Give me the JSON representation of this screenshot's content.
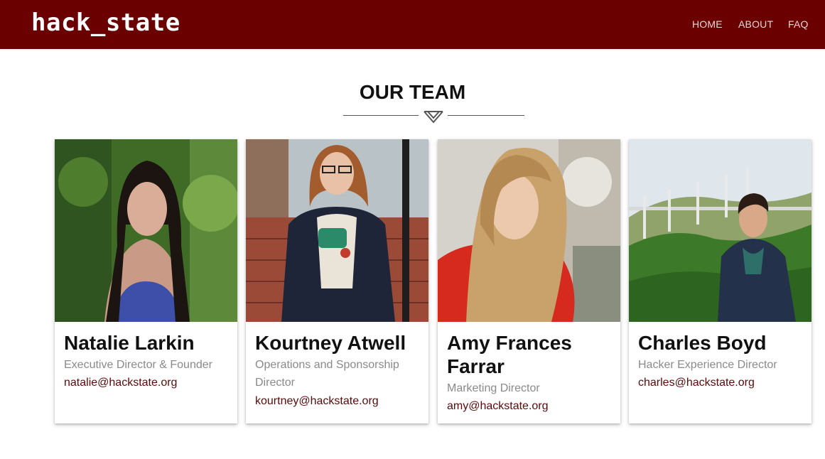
{
  "header": {
    "logo": "hack_state",
    "nav": [
      {
        "label": "HOME"
      },
      {
        "label": "ABOUT"
      },
      {
        "label": "FAQ"
      }
    ]
  },
  "section": {
    "title": "OUR TEAM",
    "divider_icon": "chevron-logo-icon"
  },
  "team": [
    {
      "name": "Natalie Larkin",
      "role": "Executive Director & Founder",
      "email": "natalie@hackstate.org"
    },
    {
      "name": "Kourtney Atwell",
      "role": "Operations and Sponsorship Director",
      "email": "kourtney@hackstate.org"
    },
    {
      "name": "Amy Frances Farrar",
      "role": "Marketing Director",
      "email": "amy@hackstate.org"
    },
    {
      "name": "Charles Boyd",
      "role": "Hacker Experience Director",
      "email": "charles@hackstate.org"
    }
  ],
  "colors": {
    "brand": "#6b0000",
    "email": "#5a0a0a",
    "role": "#8a8a8a"
  }
}
